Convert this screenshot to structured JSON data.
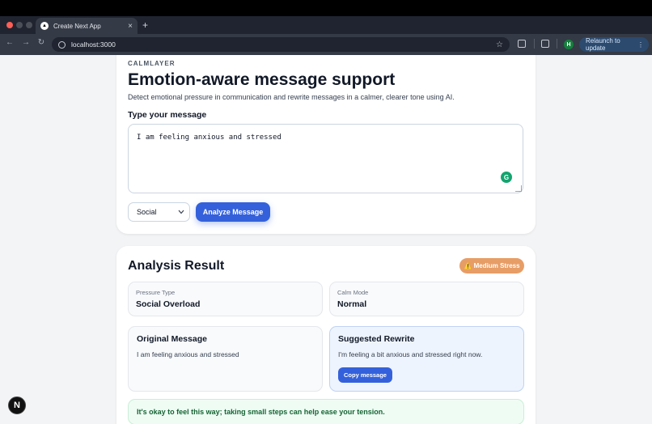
{
  "browser": {
    "tab_title": "Create Next App",
    "tab_favicon": "▲",
    "tab_close": "×",
    "new_tab": "+",
    "url": "localhost:3000",
    "profile_initial": "H",
    "relaunch_label": "Relaunch to update",
    "menu_glyph": "⋮",
    "nav": {
      "back": "←",
      "forward": "→",
      "reload": "↻"
    },
    "star": "☆"
  },
  "composer": {
    "brand": "CALMLAYER",
    "headline": "Emotion-aware message support",
    "subtitle": "Detect emotional pressure in communication and rewrite messages in a calmer, clearer tone using AI.",
    "input_label": "Type your message",
    "message_value": "I am feeling anxious and stressed",
    "context_selected": "Social",
    "analyze_button": "Analyze Message",
    "grammarly_glyph": "G"
  },
  "result": {
    "title": "Analysis Result",
    "stress_badge": "⚠️ Medium Stress",
    "pressure_type_label": "Pressure Type",
    "pressure_type_value": "Social Overload",
    "calm_mode_label": "Calm Mode",
    "calm_mode_value": "Normal",
    "original_title": "Original Message",
    "original_text": "I am feeling anxious and stressed",
    "rewrite_title": "Suggested Rewrite",
    "rewrite_text": "I'm feeling a bit anxious and stressed right now.",
    "copy_button": "Copy message",
    "tip": "It's okay to feel this way; taking small steps can help ease your tension."
  },
  "dev_badge": "N",
  "colors": {
    "accent": "#3461db",
    "stress_badge": "#e79d66",
    "tip_text": "#166534",
    "tip_bg": "#effcf4"
  }
}
